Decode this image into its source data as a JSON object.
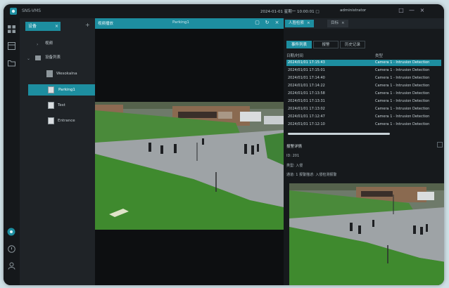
{
  "window": {
    "app_title": "SNS-VMS",
    "info_text": "2024-01-01 星期一 10:00:01 □",
    "user_text": "administrator",
    "controls": [
      "□",
      "—",
      "×"
    ]
  },
  "rail": {
    "icons": [
      "grid-icon",
      "layout-icon",
      "folder-icon",
      "settings-icon",
      "alert-icon",
      "user-icon"
    ]
  },
  "tree": {
    "tab_label": "设备",
    "tab_close": "×",
    "add_symbol": "+",
    "root_label": "视频",
    "group_label": "设备列表",
    "items": [
      {
        "label": "Wesokalna",
        "selected": false
      },
      {
        "label": "Parking1",
        "selected": true
      },
      {
        "label": "Test",
        "selected": false
      },
      {
        "label": "Entrance",
        "selected": false
      }
    ]
  },
  "video": {
    "header_title": "视频播放",
    "header_center": "Parking1",
    "controls": [
      "▢",
      "↻",
      "×"
    ]
  },
  "right": {
    "tabs": [
      {
        "label": "人脸检索",
        "active": true
      },
      {
        "label": "目标",
        "active": false
      }
    ],
    "segments": [
      "事件列表",
      "报警",
      "历史记录"
    ],
    "col_time": "日期/时间",
    "col_type": "类型",
    "rows": [
      {
        "time": "2024/01/01 17:15:43",
        "type": "Camera 1 - Intrusion Detection",
        "selected": true
      },
      {
        "time": "2024/01/01 17:15:01",
        "type": "Camera 1 - Intrusion Detection",
        "selected": false
      },
      {
        "time": "2024/01/01 17:14:40",
        "type": "Camera 1 - Intrusion Detection",
        "selected": false
      },
      {
        "time": "2024/01/01 17:14:22",
        "type": "Camera 1 - Intrusion Detection",
        "selected": false
      },
      {
        "time": "2024/01/01 17:13:58",
        "type": "Camera 1 - Intrusion Detection",
        "selected": false
      },
      {
        "time": "2024/01/01 17:13:31",
        "type": "Camera 1 - Intrusion Detection",
        "selected": false
      },
      {
        "time": "2024/01/01 17:13:02",
        "type": "Camera 1 - Intrusion Detection",
        "selected": false
      },
      {
        "time": "2024/01/01 17:12:47",
        "type": "Camera 1 - Intrusion Detection",
        "selected": false
      },
      {
        "time": "2024/01/01 17:12:10",
        "type": "Camera 1 - Intrusion Detection",
        "selected": false
      }
    ],
    "detail_title": "报警详情",
    "detail_props": [
      "ID: 201",
      "类型: 入侵",
      "通道: 1    报警描述: 入侵检测报警"
    ]
  },
  "colors": {
    "accent": "#1d8ea0",
    "bg": "#1b1f23"
  }
}
